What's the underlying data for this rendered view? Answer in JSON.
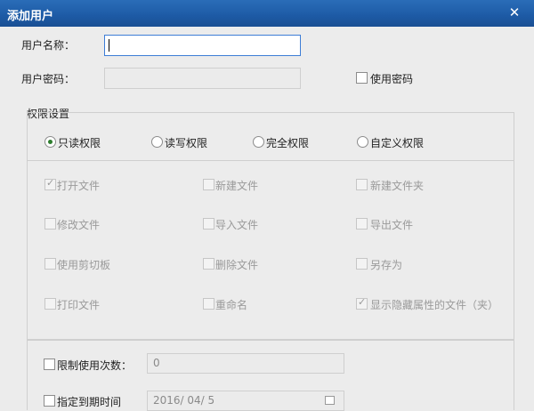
{
  "window": {
    "title": "添加用户",
    "close_glyph": "✕"
  },
  "form": {
    "username_label": "用户名称：",
    "username_value": "",
    "password_label": "用户密码：",
    "password_value": "",
    "use_password_label": "使用密码"
  },
  "permissions": {
    "group_title": "权限设置",
    "radios": [
      {
        "label": "只读权限",
        "selected": true
      },
      {
        "label": "读写权限",
        "selected": false
      },
      {
        "label": "完全权限",
        "selected": false
      },
      {
        "label": "自定义权限",
        "selected": false
      }
    ],
    "checkboxes": [
      {
        "label": "打开文件",
        "checked": true
      },
      {
        "label": "新建文件",
        "checked": false
      },
      {
        "label": "新建文件夹",
        "checked": false
      },
      {
        "label": "修改文件",
        "checked": false
      },
      {
        "label": "导入文件",
        "checked": false
      },
      {
        "label": "导出文件",
        "checked": false
      },
      {
        "label": "使用剪切板",
        "checked": false
      },
      {
        "label": "删除文件",
        "checked": false
      },
      {
        "label": "另存为",
        "checked": false
      },
      {
        "label": "打印文件",
        "checked": false
      },
      {
        "label": "重命名",
        "checked": false
      },
      {
        "label": "显示隐藏属性的文件（夹）",
        "checked": true
      }
    ]
  },
  "limits": {
    "limit_count_label": "限制使用次数：",
    "limit_count_value": "0",
    "expire_label": "指定到期时间",
    "expire_value": "2016/ 04/ 5"
  },
  "colors": {
    "titlebar": "#1d5aa5",
    "radio_dot": "#2d7d2d",
    "focus_border": "#3d7dd6"
  }
}
